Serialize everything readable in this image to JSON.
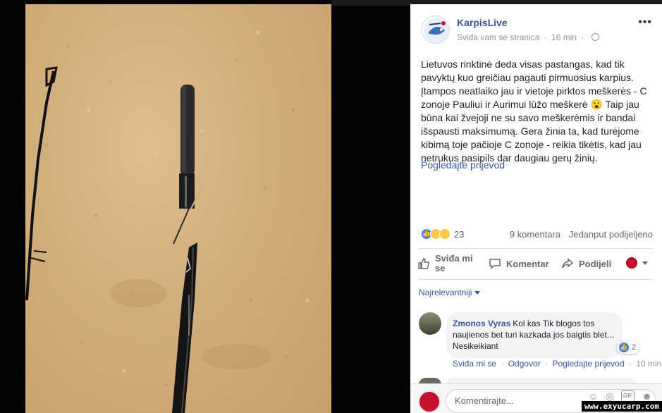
{
  "post": {
    "page_name": "KarpisLive",
    "liked_status": "Sviđa vam se stranica",
    "time": "16 min",
    "text": "Lietuvos rinktinė deda visas pastangas, kad tik pavyktų kuo greičiau pagauti pirmuosius karpius. Įtampos neatlaiko jau ir vietoje pirktos meškerės - C zonoje Pauliui ir Aurimui lūžo meškerė 😮 Taip jau būna kai žvejoji ne su savo meškerėmis ir bandai išspausti maksimumą. Gera žinia ta, kad turėjome kibimą toje pačioje C zonoje - reikia tikėtis, kad jau netrukus pasipils dar daugiau gerų žinių.",
    "translate_link": "Pogledajte prijevod",
    "reactions_count": "23",
    "comments_count": "9 komentara",
    "shares_count": "Jedanput podijeljeno"
  },
  "actions": {
    "like_label": "Sviđa mi se",
    "comment_label": "Komentar",
    "share_label": "Podijeli"
  },
  "sort_label": "Najrelevantniji",
  "comment": {
    "author": "Zmonos Vyras",
    "text": "Kol kas Tik blogos tos naujienos bet turi kazkada jos baigtis blet... Nesikeikiant",
    "likes": "2",
    "like_label": "Sviđa mi se",
    "reply_label": "Odgovor",
    "translate_label": "Pogledajte prijevod",
    "time": "10 min"
  },
  "composer": {
    "placeholder": "Komentirajte..."
  },
  "watermark": "www.exyucarp.com",
  "icons": {
    "more": "more-horizontal-icon",
    "globe": "globe-icon",
    "like": "thumbs-up-icon",
    "comment": "speech-bubble-icon",
    "share": "share-arrow-icon",
    "emoji": "emoji-icon",
    "camera": "camera-icon",
    "gif": "gif-icon",
    "sticker": "sticker-icon"
  },
  "colors": {
    "link_blue": "#385898",
    "like_blue": "#4080ff",
    "sand": "#d2ad7c"
  }
}
